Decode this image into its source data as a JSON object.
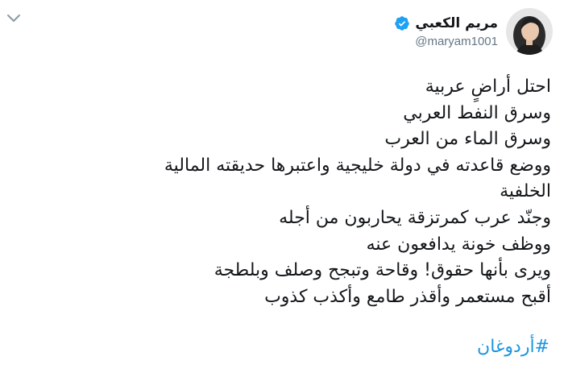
{
  "tweet": {
    "display_name": "مريم الكعبي",
    "handle": "@maryam1001",
    "lines": [
      "احتل أراضٍ عربية",
      "وسرق النفط العربي",
      "وسرق الماء من العرب",
      "ووضع قاعدته في دولة خليجية واعتبرها حديقته المالية",
      "الخلفية",
      "وجنّد عرب كمرتزقة يحاربون من أجله",
      "ووظف خونة يدافعون عنه",
      "ويرى بأنها حقوق! وقاحة وتبجح وصلف وبلطجة",
      "أقبح مستعمر وأقذر طامع وأكذب كذوب"
    ],
    "hashtag": "#أردوغان"
  },
  "colors": {
    "verified": "#1da1f2",
    "hashtag": "#1b95e0",
    "handle": "#657786"
  },
  "icons": {
    "more": "chevron-down-icon",
    "verified": "verified-badge-icon",
    "avatar": "avatar"
  }
}
